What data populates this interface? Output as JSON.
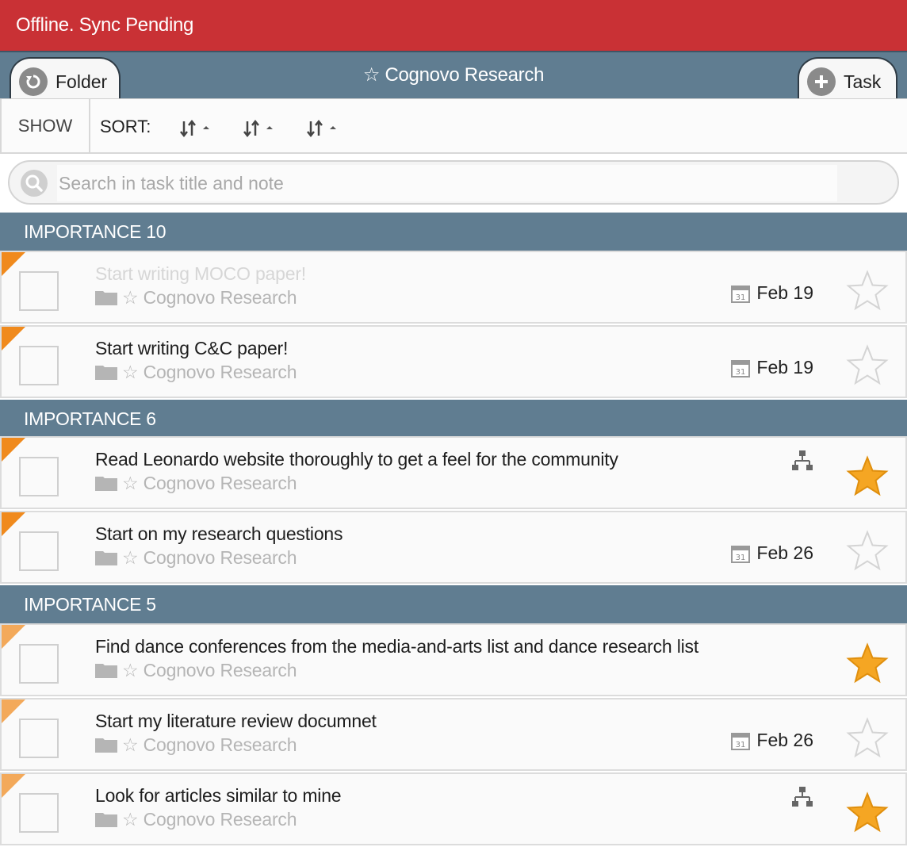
{
  "status_bar": {
    "text": "Offline. Sync Pending"
  },
  "header": {
    "title": "☆ Cognovo Research",
    "back_label": "Folder",
    "add_label": "Task"
  },
  "toolbar": {
    "show_label": "SHOW",
    "sort_label": "SORT:"
  },
  "search": {
    "placeholder": "Search in task title and note"
  },
  "colors": {
    "status_bar": "#c93135",
    "header": "#607d91",
    "importance_flag": "#f08a1d",
    "star_active": "#f5a623"
  },
  "groups": [
    {
      "label": "IMPORTANCE 10"
    },
    {
      "label": "IMPORTANCE 6"
    },
    {
      "label": "IMPORTANCE 5"
    }
  ],
  "tasks": [
    {
      "title": "Start writing MOCO paper!",
      "folder": "☆ Cognovo Research",
      "due": "Feb 19",
      "starred": false,
      "completed": true,
      "group": "IMPORTANCE 10"
    },
    {
      "title": "Start writing C&C paper!",
      "folder": "☆ Cognovo Research",
      "due": "Feb 19",
      "starred": false,
      "completed": false,
      "group": "IMPORTANCE 10"
    },
    {
      "title": "Read Leonardo website thoroughly to get a feel for the community",
      "folder": "☆ Cognovo Research",
      "due": "",
      "has_subtasks": true,
      "starred": true,
      "completed": false,
      "group": "IMPORTANCE 6"
    },
    {
      "title": "Start on my research questions",
      "folder": "☆ Cognovo Research",
      "due": "Feb 26",
      "starred": false,
      "completed": false,
      "group": "IMPORTANCE 6"
    },
    {
      "title": "Find dance conferences from the media-and-arts list and dance research list",
      "folder": "☆ Cognovo Research",
      "due": "",
      "starred": true,
      "completed": false,
      "group": "IMPORTANCE 5"
    },
    {
      "title": "Start my literature review documnet",
      "folder": "☆ Cognovo Research",
      "due": "Feb 26",
      "starred": false,
      "completed": false,
      "group": "IMPORTANCE 5"
    },
    {
      "title": "Look for articles similar to mine",
      "folder": "☆ Cognovo Research",
      "due": "",
      "has_subtasks": true,
      "starred": true,
      "completed": false,
      "group": "IMPORTANCE 5"
    }
  ]
}
